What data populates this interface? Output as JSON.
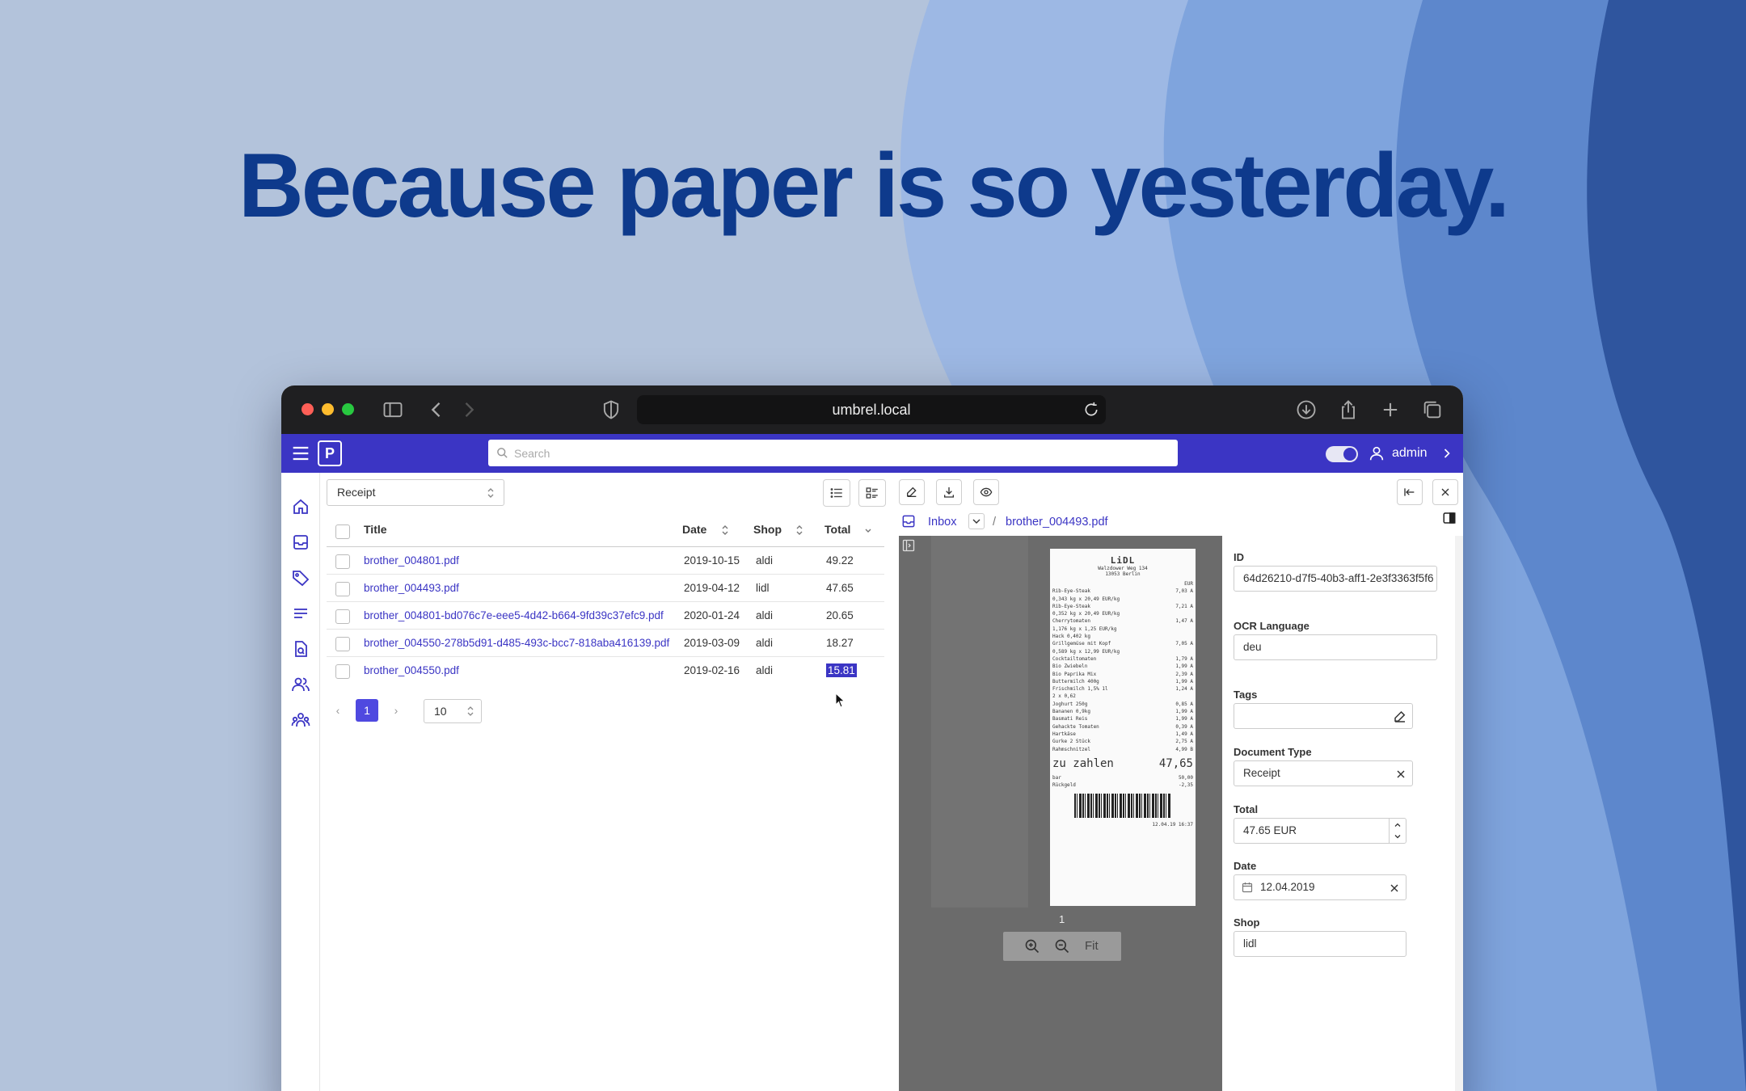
{
  "headline": "Because paper is so yesterday.",
  "browser": {
    "url": "umbrel.local"
  },
  "app": {
    "search_placeholder": "Search",
    "user": "admin"
  },
  "list": {
    "doc_type_select": "Receipt",
    "columns": {
      "title": "Title",
      "date": "Date",
      "shop": "Shop",
      "total": "Total"
    },
    "rows": [
      {
        "title": "brother_004801.pdf",
        "date": "2019-10-15",
        "shop": "aldi",
        "total": "49.22"
      },
      {
        "title": "brother_004493.pdf",
        "date": "2019-04-12",
        "shop": "lidl",
        "total": "47.65"
      },
      {
        "title": "brother_004801-bd076c7e-eee5-4d42-b664-9fd39c37efc9.pdf",
        "date": "2020-01-24",
        "shop": "aldi",
        "total": "20.65"
      },
      {
        "title": "brother_004550-278b5d91-d485-493c-bcc7-818aba416139.pdf",
        "date": "2019-03-09",
        "shop": "aldi",
        "total": "18.27"
      },
      {
        "title": "brother_004550.pdf",
        "date": "2019-02-16",
        "shop": "aldi",
        "total": "15.81"
      }
    ],
    "pager": {
      "prev": "‹",
      "current": "1",
      "next": "›",
      "page_size": "10"
    }
  },
  "viewer": {
    "breadcrumb_folder": "Inbox",
    "breadcrumb_sep": "/",
    "breadcrumb_file": "brother_004493.pdf",
    "page_number": "1",
    "zoom_fit": "Fit",
    "receipt": {
      "brand": "LiDL",
      "address1": "Walzdower Weg 134",
      "address2": "13053 Berlin",
      "currency": "EUR",
      "lines": [
        [
          "Rib-Eye-Steak",
          "7,03 A"
        ],
        [
          "0,343 kg x 20,49 EUR/kg",
          ""
        ],
        [
          "Rib-Eye-Steak",
          "7,21 A"
        ],
        [
          "0,352 kg x 20,49 EUR/kg",
          ""
        ],
        [
          "Cherrytomaten",
          "1,47 A"
        ],
        [
          "1,176 kg x 1,25 EUR/kg",
          ""
        ],
        [
          "Hack 0,402 kg",
          ""
        ],
        [
          "Grillgemüse mit Kopf",
          "7,05 A"
        ],
        [
          "0,589 kg x 12,99 EUR/kg",
          ""
        ],
        [
          "Cocktailtomaten",
          "1,79 A"
        ],
        [
          "Bio Zwiebeln",
          "1,99 A"
        ],
        [
          "Bio Paprika Mix",
          "2,39 A"
        ],
        [
          "Buttermilch 400g",
          "1,99 A"
        ],
        [
          "Frischmilch 1,5% 1l",
          "1,24 A"
        ],
        [
          "2 x 0,62",
          ""
        ],
        [
          "Joghurt 250g",
          "0,85 A"
        ],
        [
          "Bananen 0,9kg",
          "1,99 A"
        ],
        [
          "Basmati Reis",
          "1,99 A"
        ],
        [
          "Gehackte Tomaten",
          "0,39 A"
        ],
        [
          "Hartkäse",
          "1,49 A"
        ],
        [
          "Gurke 2 Stück",
          "2,75 A"
        ],
        [
          "Rahmschnitzel",
          "4,99 B"
        ]
      ],
      "to_pay_label": "zu zahlen",
      "to_pay_value": "47,65",
      "cash_label": "bar",
      "cash_value": "50,00",
      "change_label": "Rückgeld",
      "change_value": "-2,35",
      "footer": "12.04.19  16:37"
    }
  },
  "fields": {
    "id_label": "ID",
    "id_value": "64d26210-d7f5-40b3-aff1-2e3f3363f5f6",
    "ocr_label": "OCR Language",
    "ocr_value": "deu",
    "tags_label": "Tags",
    "tags_value": "",
    "doctype_label": "Document Type",
    "doctype_value": "Receipt",
    "total_label": "Total",
    "total_value": "47.65 EUR",
    "date_label": "Date",
    "date_value": "12.04.2019",
    "shop_label": "Shop",
    "shop_value": "lidl"
  },
  "colors": {
    "brand": "#3b35c4",
    "headline": "#0e3a8c",
    "highlight": "#3b35c4"
  }
}
